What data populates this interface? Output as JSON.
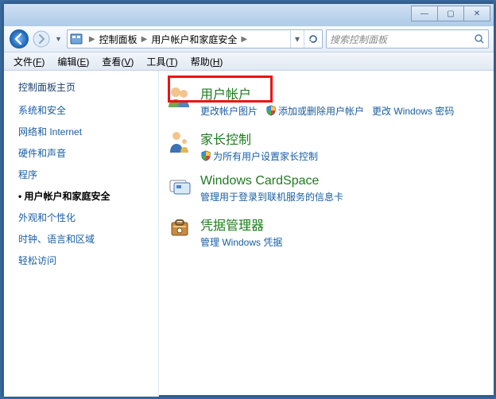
{
  "window": {
    "breadcrumbs": [
      "控制面板",
      "用户帐户和家庭安全"
    ],
    "search_placeholder": "搜索控制面板"
  },
  "menubar": [
    {
      "label": "文件",
      "key": "F"
    },
    {
      "label": "编辑",
      "key": "E"
    },
    {
      "label": "查看",
      "key": "V"
    },
    {
      "label": "工具",
      "key": "T"
    },
    {
      "label": "帮助",
      "key": "H"
    }
  ],
  "sidebar": {
    "header": "控制面板主页",
    "items": [
      {
        "label": "系统和安全",
        "active": false
      },
      {
        "label": "网络和 Internet",
        "active": false
      },
      {
        "label": "硬件和声音",
        "active": false
      },
      {
        "label": "程序",
        "active": false
      },
      {
        "label": "用户帐户和家庭安全",
        "active": true
      },
      {
        "label": "外观和个性化",
        "active": false
      },
      {
        "label": "时钟、语言和区域",
        "active": false
      },
      {
        "label": "轻松访问",
        "active": false
      }
    ]
  },
  "categories": [
    {
      "id": "user-accounts",
      "title": "用户帐户",
      "highlight": true,
      "links": [
        {
          "label": "更改帐户图片",
          "shield": false
        },
        {
          "label": "添加或删除用户帐户",
          "shield": true
        },
        {
          "label": "更改 Windows 密码",
          "shield": false
        }
      ]
    },
    {
      "id": "parental",
      "title": "家长控制",
      "links": [
        {
          "label": "为所有用户设置家长控制",
          "shield": true
        }
      ]
    },
    {
      "id": "cardspace",
      "title": "Windows CardSpace",
      "links": [
        {
          "label": "管理用于登录到联机服务的信息卡",
          "shield": false
        }
      ]
    },
    {
      "id": "credentials",
      "title": "凭据管理器",
      "links": [
        {
          "label": "管理 Windows 凭据",
          "shield": false
        }
      ]
    }
  ]
}
